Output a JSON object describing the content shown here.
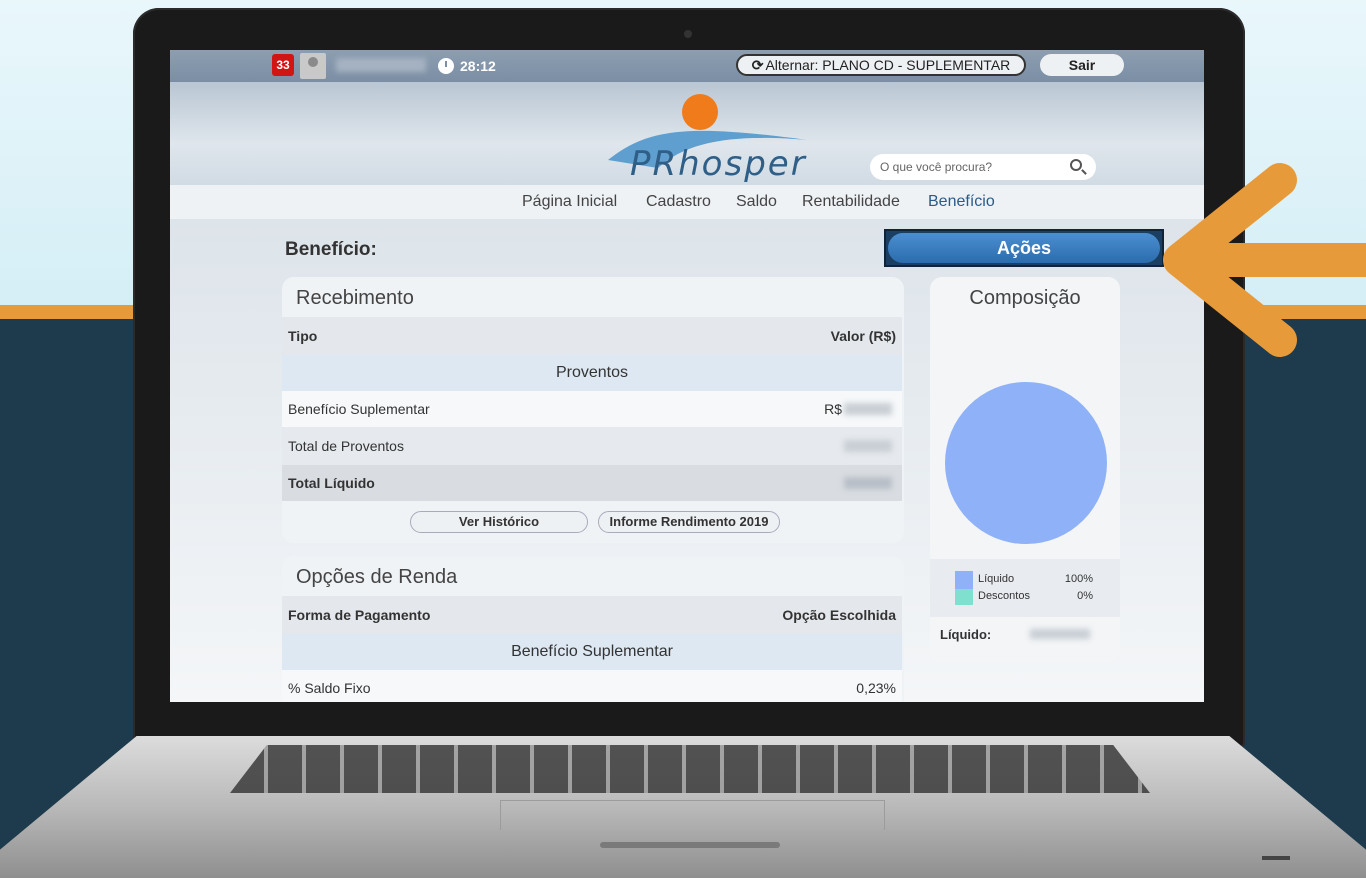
{
  "topbar": {
    "notification_count": "33",
    "timer": "28:12",
    "switch_plan": "Alternar: PLANO CD - SUPLEMENTAR",
    "exit_label": "Sair"
  },
  "header": {
    "logo_text": "PRhosper",
    "search_placeholder": "O que você procura?"
  },
  "nav": [
    "Página Inicial",
    "Cadastro",
    "Saldo",
    "Rentabilidade",
    "Benefício"
  ],
  "nav_active": "Benefício",
  "page": {
    "title": "Benefício:",
    "actions_label": "Ações"
  },
  "recebimento": {
    "title": "Recebimento",
    "col_type": "Tipo",
    "col_value": "Valor (R$)",
    "section": "Proventos",
    "rows": [
      {
        "label": "Benefício Suplementar",
        "value": "R$"
      },
      {
        "label": "Total de Proventos",
        "value": ""
      },
      {
        "label": "Total Líquido",
        "value": ""
      }
    ],
    "btn_history": "Ver Histórico",
    "btn_report": "Informe Rendimento 2019"
  },
  "opcoes": {
    "title": "Opções de Renda",
    "col_form": "Forma de Pagamento",
    "col_choice": "Opção Escolhida",
    "section": "Benefício Suplementar",
    "row_label": "% Saldo Fixo",
    "row_value": "0,23%"
  },
  "composicao": {
    "title": "Composição",
    "legend": [
      {
        "label": "Líquido",
        "value": "100%",
        "color": "#8eb1f7"
      },
      {
        "label": "Descontos",
        "value": "0%",
        "color": "#7fe0cf"
      }
    ],
    "liquido_label": "Líquido:"
  },
  "colors": {
    "accent": "#e79a3a",
    "brand": "#2f5e86",
    "button": "#2a6cae"
  }
}
